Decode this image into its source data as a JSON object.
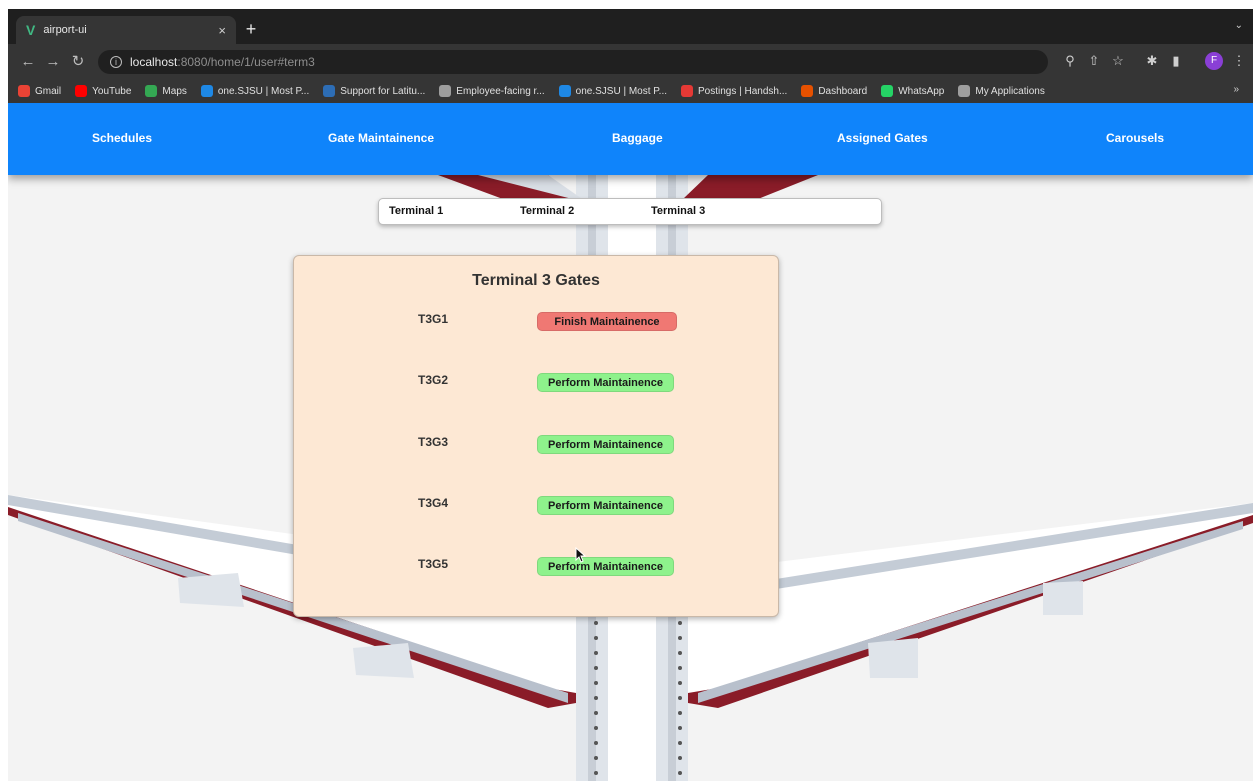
{
  "browser": {
    "tab_title": "airport-ui",
    "tab_close": "×",
    "new_tab": "+",
    "address": {
      "host": "localhost",
      "rest": ":8080/home/1/user#term3"
    },
    "bookmarks": [
      {
        "label": "Gmail",
        "color": "#ea4335"
      },
      {
        "label": "YouTube",
        "color": "#ff0000"
      },
      {
        "label": "Maps",
        "color": "#34a853"
      },
      {
        "label": "one.SJSU | Most P...",
        "color": "#1e88e5"
      },
      {
        "label": "Support for Latitu...",
        "color": "#2d6db5"
      },
      {
        "label": "Employee-facing r...",
        "color": "#9e9e9e"
      },
      {
        "label": "one.SJSU | Most P...",
        "color": "#1e88e5"
      },
      {
        "label": "Postings | Handsh...",
        "color": "#e53935"
      },
      {
        "label": "Dashboard",
        "color": "#e65100"
      },
      {
        "label": "WhatsApp",
        "color": "#25d366"
      },
      {
        "label": "My Applications",
        "color": "#9e9e9e"
      }
    ],
    "bookmarks_more": "»",
    "profile_initial": "F"
  },
  "nav": {
    "items": [
      "Schedules",
      "Gate Maintainence",
      "Baggage",
      "Assigned Gates",
      "Carousels"
    ]
  },
  "terminals": {
    "tabs": [
      "Terminal 1",
      "Terminal 2",
      "Terminal 3"
    ]
  },
  "gates_card": {
    "title": "Terminal 3 Gates",
    "gates": [
      {
        "name": "T3G1",
        "action": "Finish Maintainence",
        "status": "finish"
      },
      {
        "name": "T3G2",
        "action": "Perform Maintainence",
        "status": "perform"
      },
      {
        "name": "T3G3",
        "action": "Perform Maintainence",
        "status": "perform"
      },
      {
        "name": "T3G4",
        "action": "Perform Maintainence",
        "status": "perform"
      },
      {
        "name": "T3G5",
        "action": "Perform Maintainence",
        "status": "perform"
      }
    ]
  },
  "colors": {
    "nav_blue": "#0f84fb",
    "card_bg": "#fde8d4",
    "finish_red": "#f07873",
    "perform_green": "#8ef28c"
  }
}
